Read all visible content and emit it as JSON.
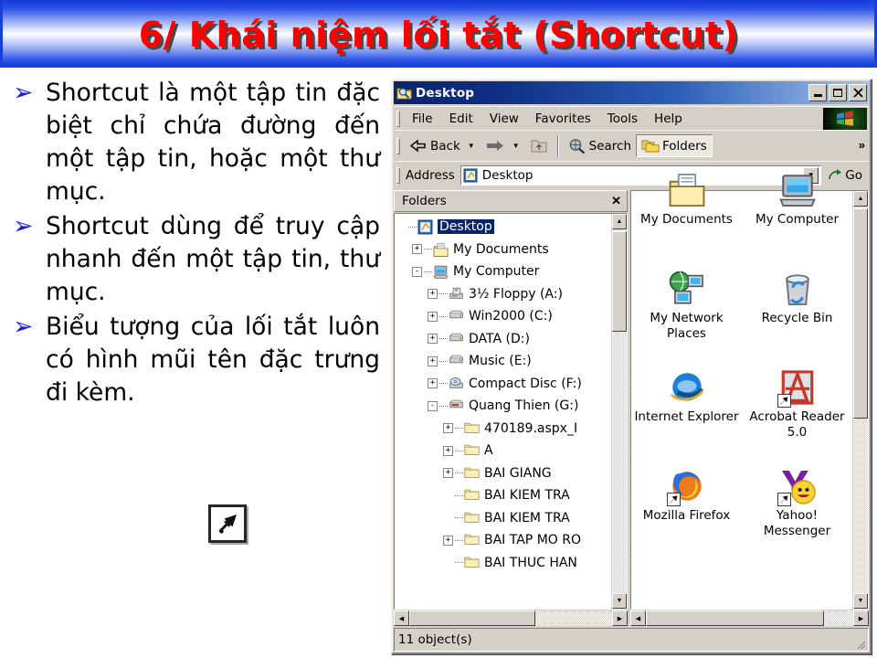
{
  "slide": {
    "title": "6/ Khái niệm lối tắt (Shortcut)",
    "title_color": "#ff0000",
    "banner_border_color": "#1a3fd8",
    "bullet_marker": "➢",
    "bullet_color": "#1a1ad0",
    "bullets": [
      "Shortcut là một tập tin đặc biệt chỉ chứa đường đến một tập tin, hoặc một thư mục.",
      "Shortcut dùng để truy cập nhanh đến một tập tin, thư mục.",
      "Biểu tượng của lối tắt luôn có hình mũi tên đặc trưng đi kèm."
    ],
    "shortcut_demo_icon": "shortcut-arrow-icon"
  },
  "explorer": {
    "titlebar": {
      "icon": "folder-search-icon",
      "title": "Desktop",
      "minimize_label": "_",
      "maximize_label": "□",
      "close_label": "✕"
    },
    "menubar": {
      "items": [
        "File",
        "Edit",
        "View",
        "Favorites",
        "Tools",
        "Help"
      ],
      "logo": "windows-flag-logo"
    },
    "toolbar": {
      "back_label": "Back",
      "back_icon": "arrow-left-icon",
      "forward_icon": "arrow-right-icon",
      "up_icon": "folder-up-icon",
      "search_label": "Search",
      "search_icon": "magnifier-globe-icon",
      "folders_label": "Folders",
      "folders_icon": "folders-icon",
      "folders_pressed": true,
      "chevron_label": "»",
      "dropdown_glyph": "▼"
    },
    "address": {
      "label": "Address",
      "icon": "desktop-icon",
      "value": "Desktop",
      "placeholder": "Desktop",
      "dropdown_glyph": "▼",
      "go_label": "Go",
      "go_icon": "go-arrow-icon"
    },
    "tree": {
      "header_label": "Folders",
      "close_label": "✕",
      "nodes": [
        {
          "label": "Desktop",
          "indent": 0,
          "expander": "",
          "icon": "desktop-icon",
          "selected": true
        },
        {
          "label": "My Documents",
          "indent": 1,
          "expander": "+",
          "icon": "my-documents-icon",
          "selected": false
        },
        {
          "label": "My Computer",
          "indent": 1,
          "expander": "-",
          "icon": "my-computer-icon",
          "selected": false
        },
        {
          "label": "3½ Floppy (A:)",
          "indent": 2,
          "expander": "+",
          "icon": "floppy-drive-icon",
          "selected": false
        },
        {
          "label": "Win2000 (C:)",
          "indent": 2,
          "expander": "+",
          "icon": "hard-drive-icon",
          "selected": false
        },
        {
          "label": "DATA (D:)",
          "indent": 2,
          "expander": "+",
          "icon": "hard-drive-icon",
          "selected": false
        },
        {
          "label": "Music (E:)",
          "indent": 2,
          "expander": "+",
          "icon": "hard-drive-icon",
          "selected": false
        },
        {
          "label": "Compact Disc (F:)",
          "indent": 2,
          "expander": "+",
          "icon": "cd-drive-icon",
          "selected": false
        },
        {
          "label": "Quang Thien (G:)",
          "indent": 2,
          "expander": "-",
          "icon": "removable-drive-icon",
          "selected": false
        },
        {
          "label": "470189.aspx_I",
          "indent": 3,
          "expander": "+",
          "icon": "folder-icon",
          "selected": false
        },
        {
          "label": "A",
          "indent": 3,
          "expander": "+",
          "icon": "folder-icon",
          "selected": false
        },
        {
          "label": "BAI GIANG",
          "indent": 3,
          "expander": "+",
          "icon": "folder-icon",
          "selected": false
        },
        {
          "label": "BAI KIEM TRA",
          "indent": 3,
          "expander": "",
          "icon": "folder-icon",
          "selected": false
        },
        {
          "label": "BAI KIEM TRA",
          "indent": 3,
          "expander": "",
          "icon": "folder-icon",
          "selected": false
        },
        {
          "label": "BAI TAP MO RO",
          "indent": 3,
          "expander": "+",
          "icon": "folder-icon",
          "selected": false
        },
        {
          "label": "BAI THUC HAN",
          "indent": 3,
          "expander": "",
          "icon": "folder-icon",
          "selected": false
        }
      ],
      "scroll_up_glyph": "▲",
      "scroll_down_glyph": "▼",
      "scroll_left_glyph": "◀",
      "scroll_right_glyph": "▶"
    },
    "desktop_items": [
      {
        "label": "My Documents",
        "icon": "my-documents-icon",
        "shortcut": false
      },
      {
        "label": "My Computer",
        "icon": "my-computer-icon",
        "shortcut": false
      },
      {
        "label": "My Network Places",
        "icon": "network-places-icon",
        "shortcut": false
      },
      {
        "label": "Recycle Bin",
        "icon": "recycle-bin-icon",
        "shortcut": false
      },
      {
        "label": "Internet Explorer",
        "icon": "internet-explorer-icon",
        "shortcut": false
      },
      {
        "label": "Acrobat Reader 5.0",
        "icon": "acrobat-reader-icon",
        "shortcut": true
      },
      {
        "label": "Mozilla Firefox",
        "icon": "firefox-icon",
        "shortcut": true
      },
      {
        "label": "Yahoo! Messenger",
        "icon": "yahoo-messenger-icon",
        "shortcut": true
      }
    ],
    "statusbar": {
      "text": "11 object(s)"
    }
  }
}
